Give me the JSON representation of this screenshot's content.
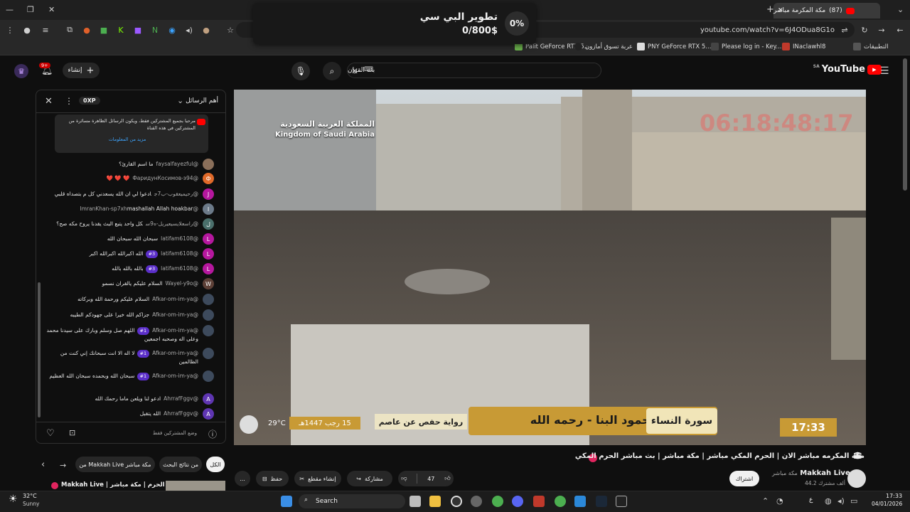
{
  "browser": {
    "active_tab": {
      "title": "مكة المكرمة مباشر",
      "badge": "(87)"
    },
    "url": "youtube.com/watch?v=6J4ODua8G1o",
    "bookmarks": [
      "Palit GeForce RTX 5...",
      "عربة تسوق أمازون",
      "PNY GeForce RTX 5...",
      "Please log in - Key...",
      "INaclawhl8",
      "التطبيقات"
    ],
    "new_tab_label": "+"
  },
  "popup": {
    "percent": "0%",
    "title": "تطوير البي سي",
    "amount": "0/800$"
  },
  "youtube": {
    "logo": "YouTube",
    "region": "SA",
    "search_value": "بث القران",
    "create_label": "إنشاء",
    "notif_count": "9+"
  },
  "chat": {
    "header_title": "أهم الرسائل",
    "xp": "0XP",
    "pinned_text": "مرحبا بجميع المشتركين فقط، ويكون الرسائل الظاهرة مسائرة من المشتركين في هذه القناة",
    "pinned_more": "مزيد من المعلومات",
    "messages": [
      {
        "user": "@faysalfayezful",
        "text": "ما اسم القارئ؟",
        "avatar": "",
        "color": "#8a6f5a"
      },
      {
        "user": "@ФаридунКосимов-э94",
        "text": "❤️ ❤️ ❤️",
        "avatar": "Ф",
        "color": "#e06a2a"
      },
      {
        "user": "@رحيميعقوب-ب7ج",
        "text": "ادعوا لي ان الله يسعدني كل م بتصداه قلبي",
        "avatar": "J",
        "color": "#b5179e"
      },
      {
        "user": "@ImranKhan-sp7xh",
        "text": "mashallah Allah hoakbar",
        "avatar": "I",
        "color": "#6c7a89"
      },
      {
        "user": "@راسعلايسيعيريل-ه9س",
        "text": "كل واحد يتبع البث يقدنا يروح مكه صح؟",
        "avatar": "ل",
        "color": "#4a6f6b"
      },
      {
        "user": "@latifam6108",
        "text": "سبحان الله سبحان الله",
        "avatar": "L",
        "color": "#b5179e"
      },
      {
        "user": "@latifam6108",
        "text": "الله اكبرالله اكبرالله اكبر",
        "avatar": "L",
        "color": "#b5179e",
        "badge": "#3"
      },
      {
        "user": "@latifam6108",
        "text": "بالله بالله بالله",
        "avatar": "L",
        "color": "#b5179e",
        "badge": "#3"
      },
      {
        "user": "@Wayel-y9o",
        "text": "السلام عليكم يالقران نسمو",
        "avatar": "W",
        "color": "#5d4037"
      },
      {
        "user": "@Afkar-om-im-ya",
        "text": "السلام عليكم ورحمة الله وبركاته",
        "avatar": "",
        "color": "#3d4a5c"
      },
      {
        "user": "@Afkar-om-im-ya",
        "text": "جزاكم الله خيرا على جهودكم الطيبه",
        "avatar": "",
        "color": "#3d4a5c"
      },
      {
        "user": "@Afkar-om-im-ya",
        "text": "اللهم صل وسلم وبارك على سيدنا محمد وعلى اله وصحبه اجمعين",
        "avatar": "",
        "color": "#3d4a5c",
        "badge": "#1"
      },
      {
        "user": "@Afkar-om-im-ya",
        "text": "لا اله الا انت سبحانك إني كنت من الظالمين",
        "avatar": "",
        "color": "#3d4a5c",
        "badge": "#1"
      },
      {
        "user": "@Afkar-om-im-ya",
        "text": "سبحان الله وبحمده سبحان الله العظيم",
        "avatar": "",
        "color": "#3d4a5c",
        "badge": "#1"
      },
      {
        "user": "@AhrrafFggv",
        "text": "ادعو لنا ويلعن ماما رحمك الله",
        "avatar": "A",
        "color": "#5e35b1"
      },
      {
        "user": "@AhrrafFggv",
        "text": "الله يتقبل",
        "avatar": "A",
        "color": "#5e35b1"
      }
    ],
    "footer_text": "وضع المشتركين فقط"
  },
  "player": {
    "overlay_ar": "المملكة العربية السعودية",
    "overlay_en": "Kingdom of Saudi Arabia",
    "clock": "06:18:48:17",
    "reader": "القارئ : محمود البنا - رحمه الله",
    "surah": "سورة النساء",
    "riwaya": "رواية حفص عن عاصم",
    "date": "15 رجب 1447هـ",
    "temp": "29°C",
    "time": "17:33"
  },
  "video": {
    "title": "مكه المكرمه مباشر الان | الحرم المكي مباشر | مكة مباشر | بث مباشر الحرم المكي",
    "channel": "Makkah Live",
    "channel_ar": "مكة مباشر",
    "subs": "44.2 ألف مشترك",
    "subscribe_label": "اشتراك",
    "likes": "47",
    "share_label": "مشاركة",
    "clip_label": "إنشاء مقطع",
    "save_label": "حفظ",
    "more_label": "..."
  },
  "chips": [
    "الكل",
    "من نتائج البحث",
    "من Makkah Live مكة مباشر"
  ],
  "reco": {
    "title": "Makkah Live | الحرم | مكة مباشر"
  },
  "taskbar": {
    "weather_temp": "32°C",
    "weather_desc": "Sunny",
    "search": "Search",
    "time": "17:33",
    "date": "04/01/2026",
    "lang": "ع"
  }
}
